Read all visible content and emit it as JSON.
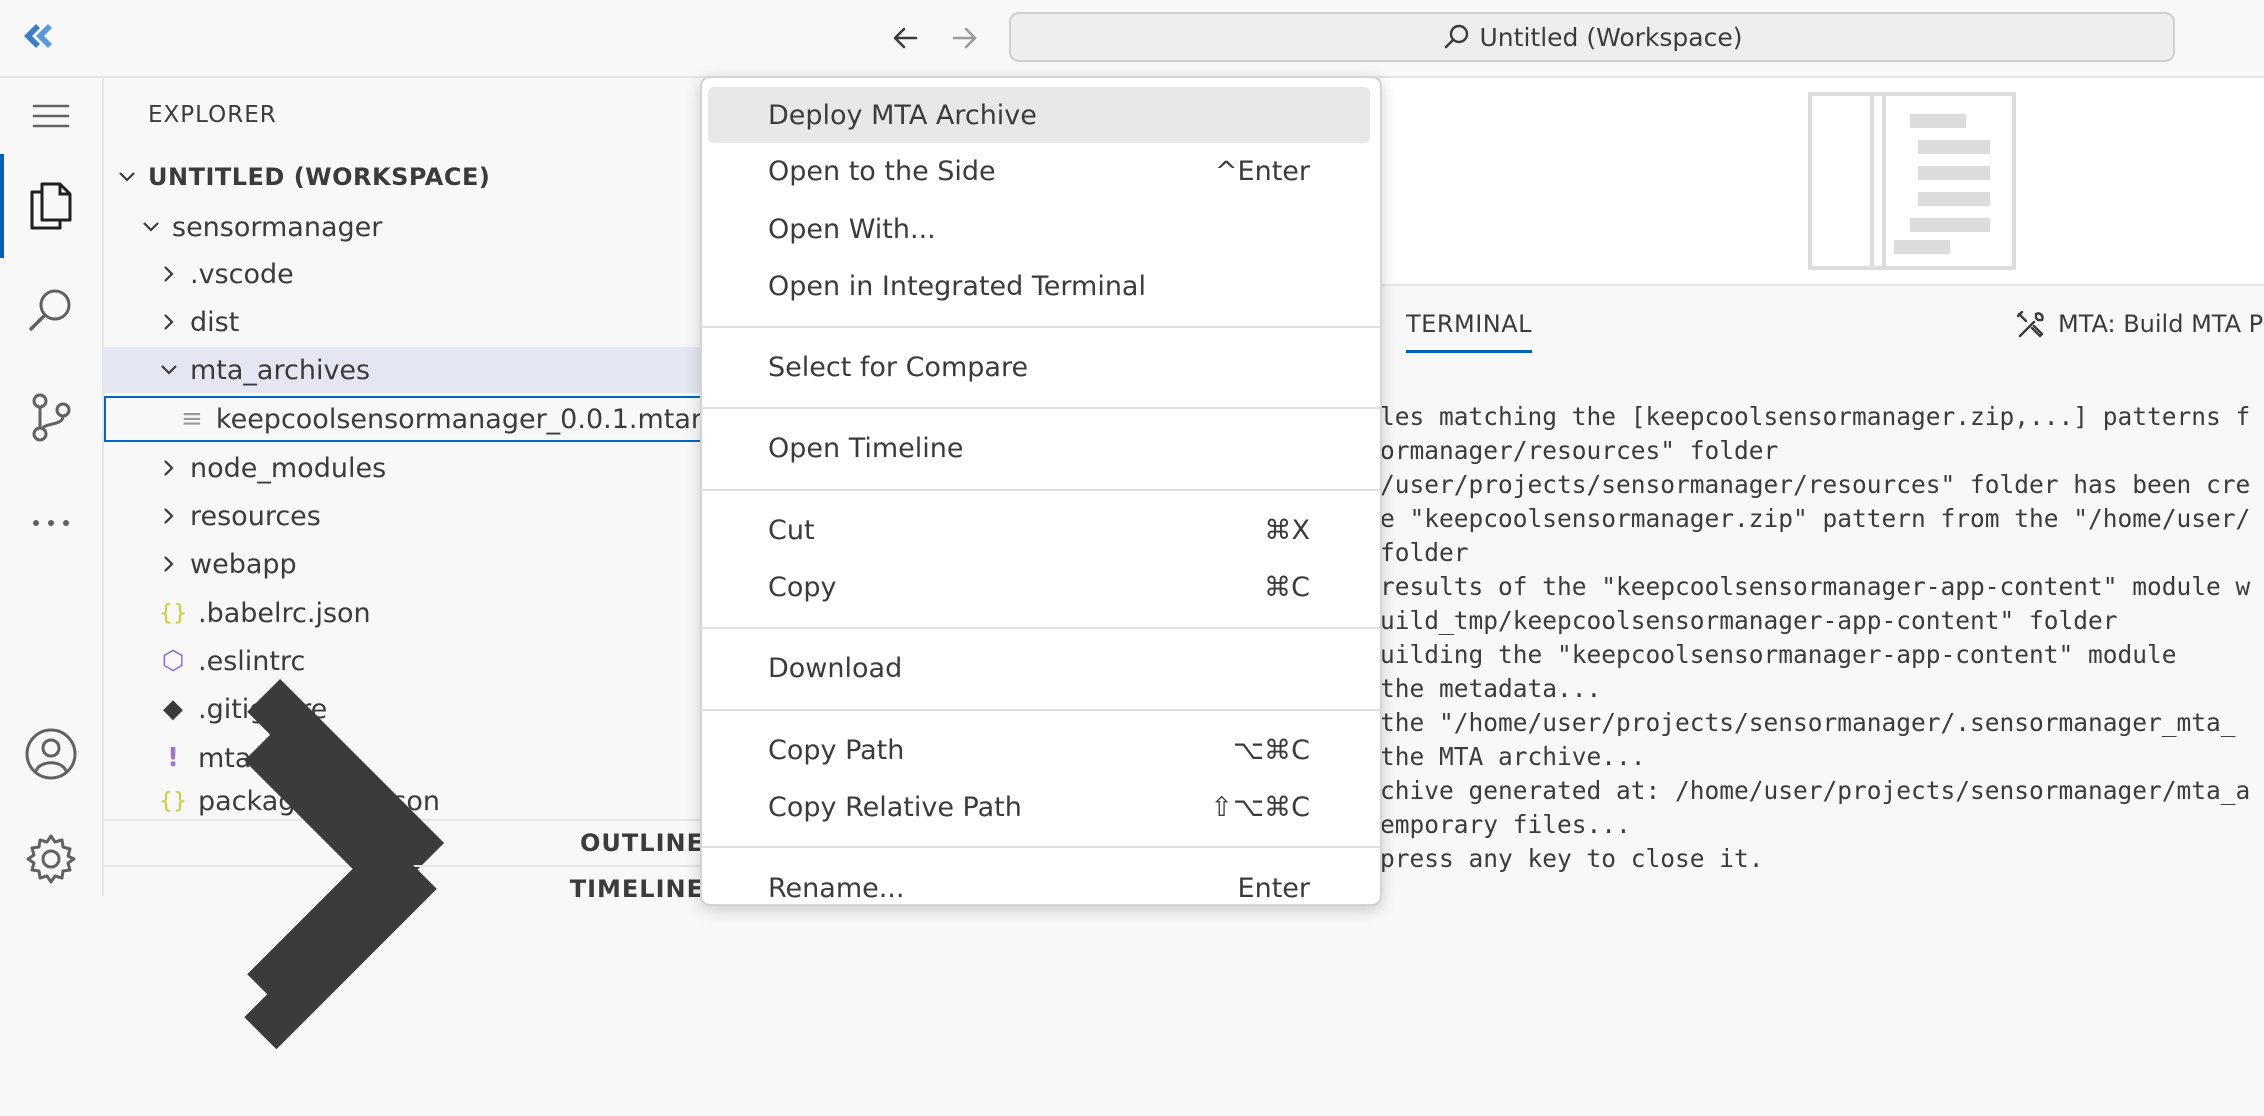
{
  "titlebar": {
    "command_center": "Untitled (Workspace)"
  },
  "explorer": {
    "title": "EXPLORER",
    "workspace": "UNTITLED (WORKSPACE)",
    "tree": [
      {
        "label": "sensormanager",
        "kind": "folder-open",
        "depth": 1
      },
      {
        "label": ".vscode",
        "kind": "folder",
        "depth": 2
      },
      {
        "label": "dist",
        "kind": "folder",
        "depth": 2
      },
      {
        "label": "mta_archives",
        "kind": "folder-open",
        "depth": 2,
        "selected": true
      },
      {
        "label": "keepcoolsensormanager_0.0.1.mtar",
        "kind": "file",
        "depth": 3,
        "focused": true
      },
      {
        "label": "node_modules",
        "kind": "folder",
        "depth": 2
      },
      {
        "label": "resources",
        "kind": "folder",
        "depth": 2
      },
      {
        "label": "webapp",
        "kind": "folder",
        "depth": 2
      },
      {
        "label": ".babelrc.json",
        "kind": "json",
        "depth": 2
      },
      {
        "label": ".eslintrc",
        "kind": "eslint",
        "depth": 2
      },
      {
        "label": ".gitignore",
        "kind": "git",
        "depth": 2
      },
      {
        "label": "mta.yaml",
        "kind": "yaml",
        "depth": 2
      },
      {
        "label": "package-lock.json",
        "kind": "json",
        "depth": 2
      }
    ],
    "outline": "OUTLINE",
    "timeline": "TIMELINE"
  },
  "panel": {
    "tab": "TERMINAL",
    "task": "MTA: Build MTA P",
    "lines": [
      "les matching the [keepcoolsensormanager.zip,...] patterns f",
      "ormanager/resources\" folder",
      "/user/projects/sensormanager/resources\" folder has been cre",
      "e \"keepcoolsensormanager.zip\" pattern from the \"/home/user/",
      " folder",
      "results of the \"keepcoolsensormanager-app-content\" module w",
      "uild_tmp/keepcoolsensormanager-app-content\" folder",
      "uilding the \"keepcoolsensormanager-app-content\" module",
      " the metadata...",
      " the \"/home/user/projects/sensormanager/.sensormanager_mta_",
      " the MTA archive...",
      "chive generated at: /home/user/projects/sensormanager/mta_a",
      "emporary files...",
      "press any key to close it."
    ]
  },
  "context_menu": {
    "items": [
      {
        "label": "Deploy MTA Archive",
        "shortcut": ""
      },
      {
        "label": "Open to the Side",
        "shortcut": "^Enter"
      },
      {
        "label": "Open With...",
        "shortcut": ""
      },
      {
        "label": "Open in Integrated Terminal",
        "shortcut": ""
      },
      {
        "label": "Select for Compare",
        "shortcut": ""
      },
      {
        "label": "Open Timeline",
        "shortcut": ""
      },
      {
        "label": "Cut",
        "shortcut": "⌘X"
      },
      {
        "label": "Copy",
        "shortcut": "⌘C"
      },
      {
        "label": "Download",
        "shortcut": ""
      },
      {
        "label": "Copy Path",
        "shortcut": "⌥⌘C"
      },
      {
        "label": "Copy Relative Path",
        "shortcut": "⇧⌥⌘C"
      },
      {
        "label": "Rename...",
        "shortcut": "Enter"
      }
    ]
  },
  "icons": {
    "app": "app-logo-icon",
    "back": "arrow-left-icon",
    "forward": "arrow-right-icon",
    "search": "search-icon",
    "menu": "hamburger-menu-icon",
    "explorer": "files-icon",
    "search_view": "search-icon",
    "scm": "source-control-icon",
    "more": "more-icon",
    "account": "account-icon",
    "settings": "gear-icon",
    "task": "tools-icon"
  },
  "colors": {
    "accent": "#005fb8",
    "selection": "#e4e6f1",
    "menu_highlight": "#e8e8e8"
  }
}
